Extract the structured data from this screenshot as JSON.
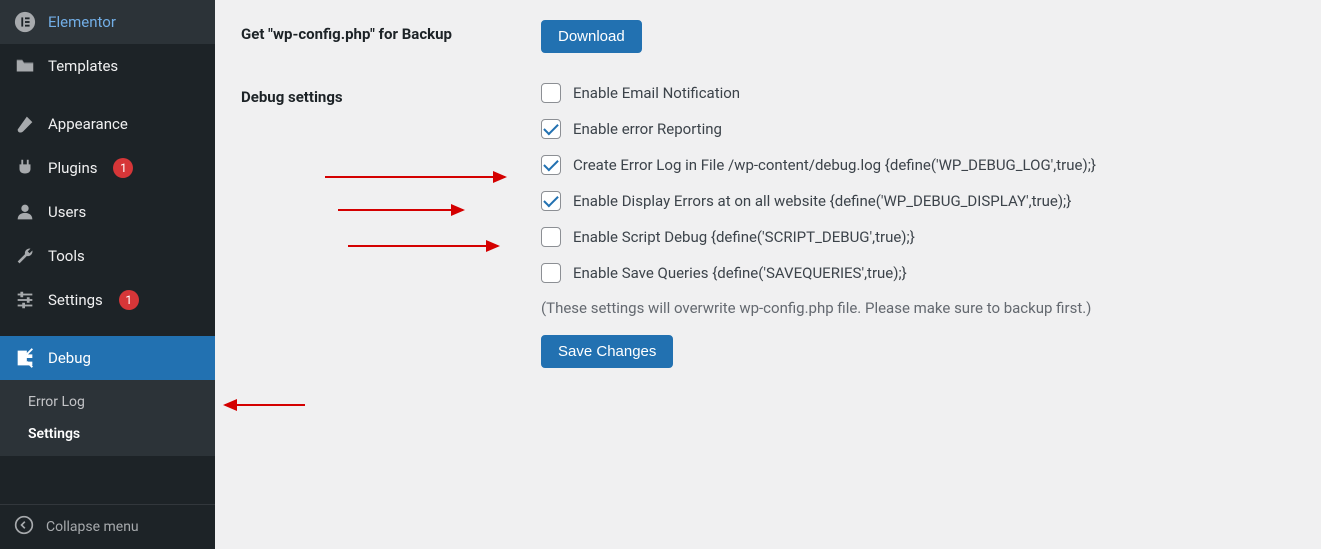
{
  "sidebar": {
    "items": [
      {
        "label": "Elementor",
        "icon": "elementor"
      },
      {
        "label": "Templates",
        "icon": "templates"
      },
      {
        "label": "Appearance",
        "icon": "appearance"
      },
      {
        "label": "Plugins",
        "icon": "plugins",
        "badge": "1"
      },
      {
        "label": "Users",
        "icon": "users"
      },
      {
        "label": "Tools",
        "icon": "tools"
      },
      {
        "label": "Settings",
        "icon": "settings",
        "badge": "1"
      },
      {
        "label": "Debug",
        "icon": "debug",
        "active": true
      }
    ],
    "submenu": [
      {
        "label": "Error Log"
      },
      {
        "label": "Settings",
        "current": true
      }
    ],
    "collapse": "Collapse menu"
  },
  "main": {
    "backup_label": "Get \"wp-config.php\" for Backup",
    "download_btn": "Download",
    "debug_label": "Debug settings",
    "checks": [
      {
        "label": "Enable Email Notification",
        "checked": false
      },
      {
        "label": "Enable error Reporting",
        "checked": true
      },
      {
        "label": "Create Error Log in File /wp-content/debug.log {define('WP_DEBUG_LOG',true);}",
        "checked": true
      },
      {
        "label": "Enable Display Errors at on all website {define('WP_DEBUG_DISPLAY',true);}",
        "checked": true
      },
      {
        "label": "Enable Script Debug {define('SCRIPT_DEBUG',true);}",
        "checked": false
      },
      {
        "label": "Enable Save Queries {define('SAVEQUERIES',true);}",
        "checked": false
      }
    ],
    "hint": "(These settings will overwrite wp-config.php file. Please make sure to backup first.)",
    "save_btn": "Save Changes"
  }
}
